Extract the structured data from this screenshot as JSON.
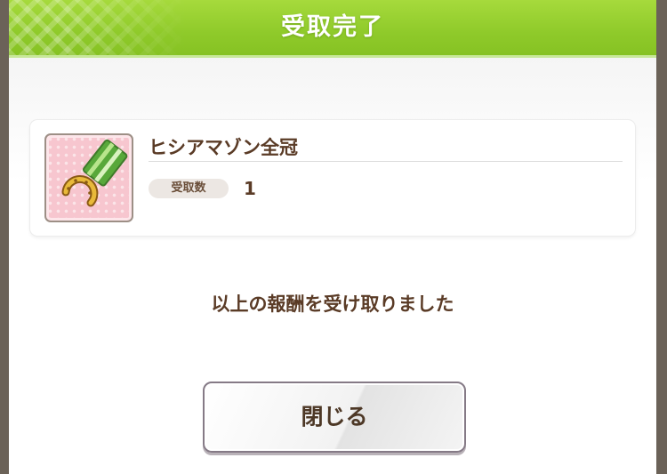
{
  "dialog": {
    "title": "受取完了",
    "reward": {
      "item_name": "ヒシアマゾン全冠",
      "quantity_label": "受取数",
      "quantity_value": "1",
      "icon": "medal-icon"
    },
    "message": "以上の報酬を受け取りました",
    "close_button_label": "閉じる"
  },
  "colors": {
    "header_green": "#8fca2a",
    "text_brown": "#5a3b26",
    "item_bg_pink": "#f7c6cf"
  }
}
